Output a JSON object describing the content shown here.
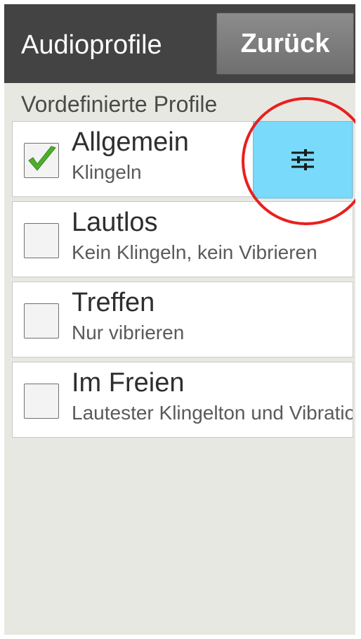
{
  "header": {
    "title": "Audioprofile",
    "back_label": "Zurück"
  },
  "section_label": "Vordefinierte Profile",
  "profiles": [
    {
      "name": "Allgemein",
      "description": "Klingeln",
      "checked": true
    },
    {
      "name": "Lautlos",
      "description": "Kein Klingeln, kein Vibrieren",
      "checked": false
    },
    {
      "name": "Treffen",
      "description": "Nur vibrieren",
      "checked": false
    },
    {
      "name": "Im Freien",
      "description": "Lautester Klingelton und Vibration",
      "checked": false
    }
  ],
  "settings_button": {
    "icon": "sliders-icon",
    "color": "#79dafb"
  },
  "annotation": {
    "shape": "circle",
    "color": "#e8201e"
  },
  "colors": {
    "titlebar": "#434343",
    "background": "#e8e8e2",
    "checkmark": "#4caf2a"
  }
}
